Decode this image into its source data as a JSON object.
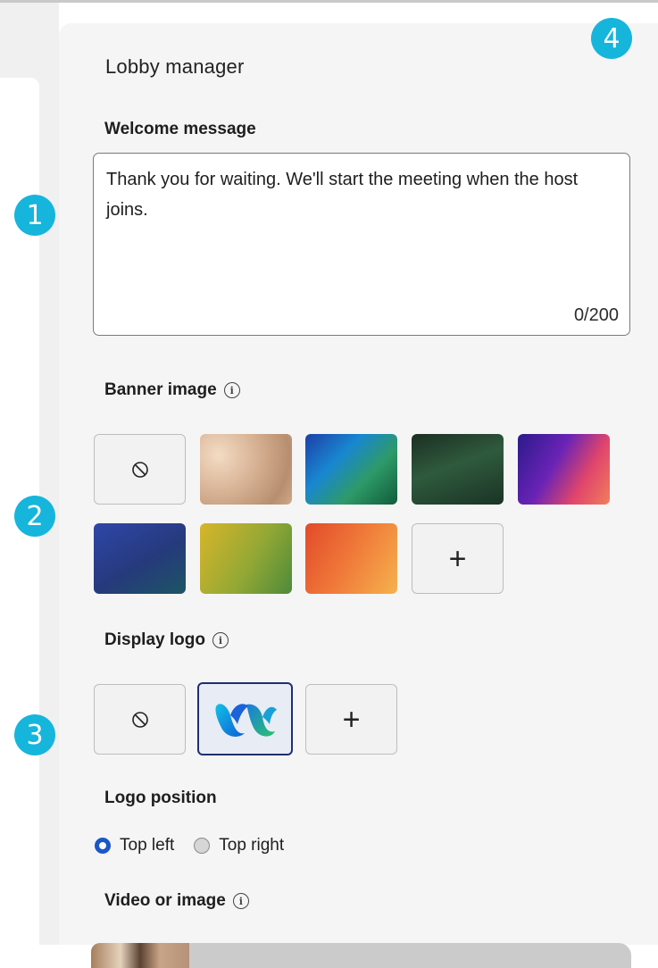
{
  "panel": {
    "title": "Lobby manager",
    "welcome": {
      "label": "Welcome message",
      "text": "Thank you for waiting. We'll start the meeting when the host joins.",
      "counter": "0/200"
    },
    "banner": {
      "label": "Banner image",
      "info_icon": "info-icon",
      "options": [
        {
          "kind": "none",
          "icon": "none-icon"
        },
        {
          "kind": "image",
          "name": "sand"
        },
        {
          "kind": "image",
          "name": "blue-green"
        },
        {
          "kind": "image",
          "name": "dark-green"
        },
        {
          "kind": "image",
          "name": "purple-red"
        },
        {
          "kind": "image",
          "name": "indigo"
        },
        {
          "kind": "image",
          "name": "yellow-green"
        },
        {
          "kind": "image",
          "name": "orange"
        },
        {
          "kind": "add",
          "icon": "plus-icon"
        }
      ]
    },
    "logo": {
      "label": "Display logo",
      "info_icon": "info-icon",
      "options": [
        {
          "kind": "none",
          "icon": "none-icon"
        },
        {
          "kind": "logo",
          "icon": "webex-logo-icon",
          "selected": true
        },
        {
          "kind": "add",
          "icon": "plus-icon"
        }
      ]
    },
    "position": {
      "label": "Logo position",
      "options": [
        {
          "label": "Top left",
          "checked": true
        },
        {
          "label": "Top right",
          "checked": false
        }
      ]
    },
    "video": {
      "label": "Video or image",
      "info_icon": "info-icon"
    }
  },
  "badges": [
    "1",
    "2",
    "3",
    "4"
  ],
  "colors": {
    "badge": "#16b5dc",
    "radio_checked": "#1a57c9",
    "selected_border": "#1f2f6f",
    "panel_bg": "#f5f5f5"
  }
}
